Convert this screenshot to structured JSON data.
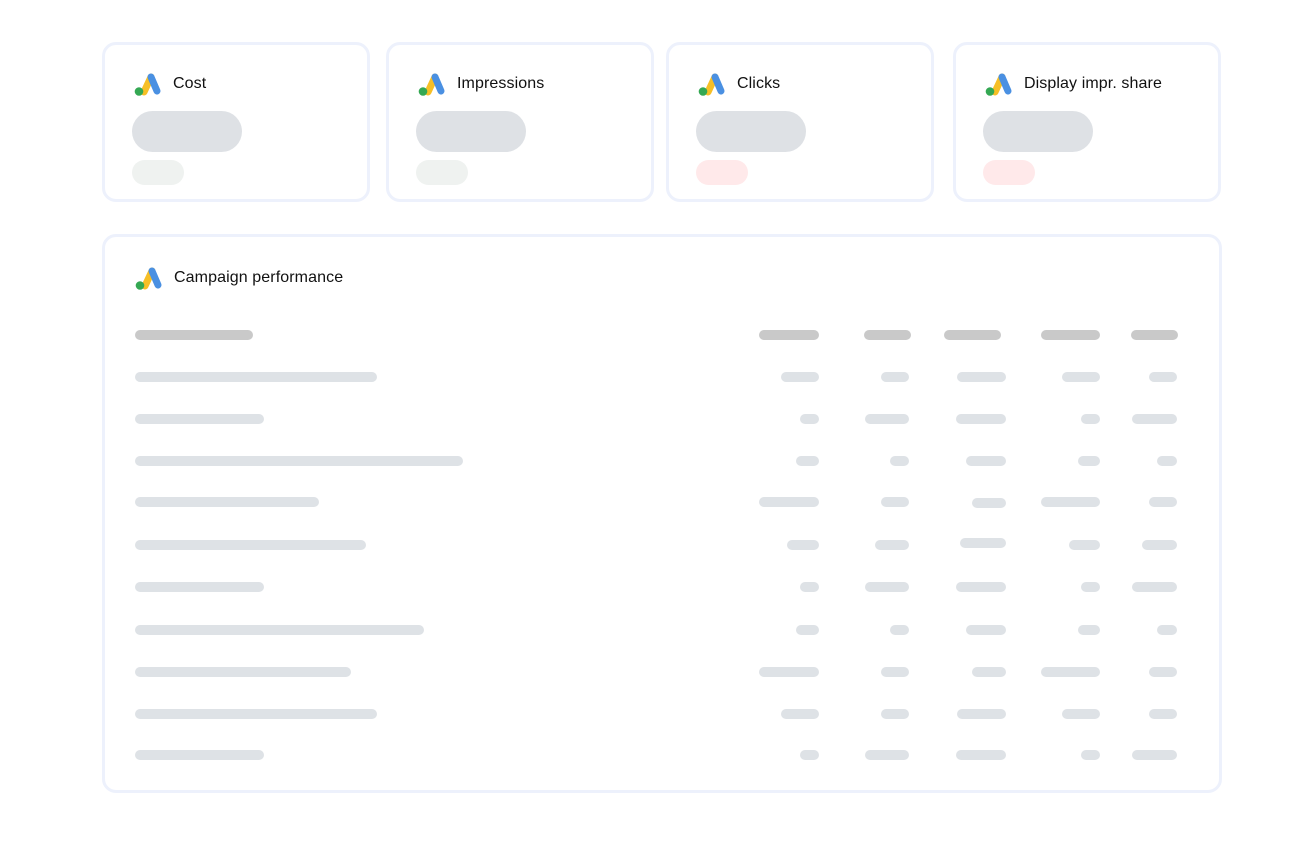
{
  "colors": {
    "card_border": "#edf1fc",
    "value_placeholder": "#dee1e5",
    "delta_neutral": "#eff2f0",
    "delta_negative": "#ffe9ea",
    "table_header_placeholder": "#c9c9c9",
    "table_cell_placeholder": "#dee2e6",
    "logo_blue": "#4a90e2",
    "logo_yellow": "#f6bf26",
    "logo_green": "#34a853"
  },
  "metrics": [
    {
      "title": "Cost",
      "icon": "google-ads-logo-icon",
      "value": "",
      "delta": "",
      "delta_state": "neutral"
    },
    {
      "title": "Impressions",
      "icon": "google-ads-logo-icon",
      "value": "",
      "delta": "",
      "delta_state": "neutral"
    },
    {
      "title": "Clicks",
      "icon": "google-ads-logo-icon",
      "value": "",
      "delta": "",
      "delta_state": "negative"
    },
    {
      "title": "Display impr. share",
      "icon": "google-ads-logo-icon",
      "value": "",
      "delta": "",
      "delta_state": "negative"
    }
  ],
  "table": {
    "title": "Campaign performance",
    "icon": "google-ads-logo-icon",
    "loading": true,
    "column_count": 6,
    "row_count": 10
  }
}
